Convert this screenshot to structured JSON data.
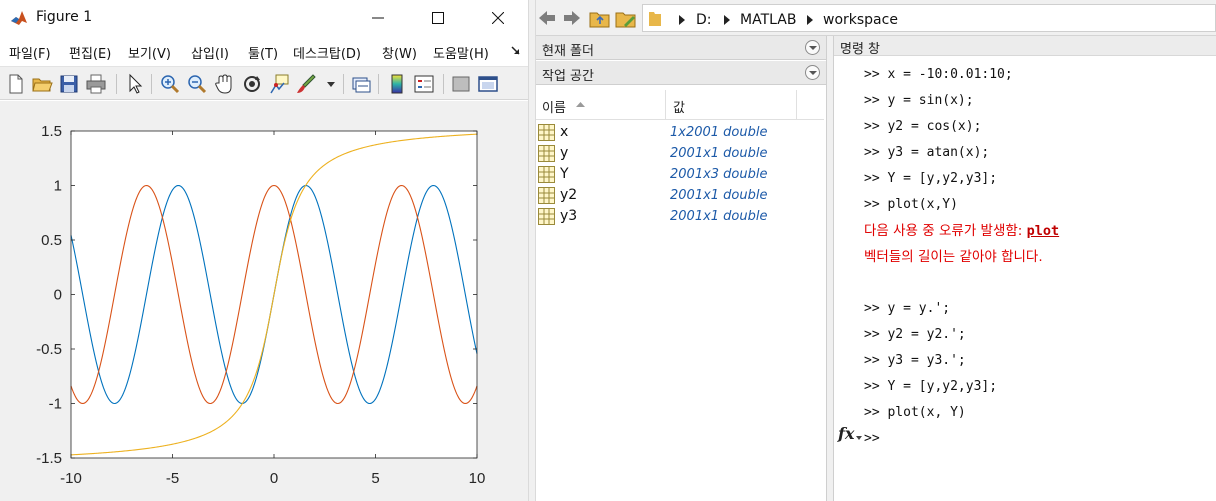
{
  "figure": {
    "title": "Figure 1",
    "menu": [
      "파일(F)",
      "편집(E)",
      "보기(V)",
      "삽입(I)",
      "툴(T)",
      "데스크탑(D)",
      "창(W)",
      "도움말(H)"
    ],
    "toolbar_icons": [
      "new-figure-icon",
      "open-file-icon",
      "save-icon",
      "print-icon",
      "select-arrow-icon",
      "zoom-in-icon",
      "zoom-out-icon",
      "pan-hand-icon",
      "rotate-3d-icon",
      "data-cursor-icon",
      "brush-icon",
      "brush-dropdown-icon",
      "link-plot-icon",
      "colorbar-icon",
      "legend-icon",
      "hide-plot-tools-icon",
      "show-plot-tools-icon"
    ]
  },
  "address": {
    "segments": [
      "D:",
      "MATLAB",
      "workspace"
    ]
  },
  "panes": {
    "current_folder_title": "현재 폴더",
    "workspace_title": "작업 공간",
    "columns": {
      "name": "이름",
      "value": "값"
    }
  },
  "workspace": [
    {
      "name": "x",
      "value": "1x2001 double"
    },
    {
      "name": "y",
      "value": "2001x1 double"
    },
    {
      "name": "Y",
      "value": "2001x3 double"
    },
    {
      "name": "y2",
      "value": "2001x1 double"
    },
    {
      "name": "y3",
      "value": "2001x1 double"
    }
  ],
  "command_window": {
    "title": "명령 창",
    "lines": [
      {
        "text": ">> x = -10:0.01:10;",
        "type": "input"
      },
      {
        "text": ">> y = sin(x);",
        "type": "input"
      },
      {
        "text": ">> y2 = cos(x);",
        "type": "input"
      },
      {
        "text": ">> y3 = atan(x);",
        "type": "input"
      },
      {
        "text": ">> Y = [y,y2,y3];",
        "type": "input"
      },
      {
        "text": ">> plot(x,Y)",
        "type": "input"
      },
      {
        "text": "다음 사용 중 오류가 발생함: ",
        "link": "plot",
        "type": "error"
      },
      {
        "text": "벡터들의 길이는 같아야 합니다.",
        "type": "error"
      },
      {
        "text": "",
        "type": "blank"
      },
      {
        "text": ">> y = y.';",
        "type": "input"
      },
      {
        "text": ">> y2 = y2.';",
        "type": "input"
      },
      {
        "text": ">> y3 = y3.';",
        "type": "input"
      },
      {
        "text": ">> Y = [y,y2,y3];",
        "type": "input"
      },
      {
        "text": ">> plot(x, Y)",
        "type": "input"
      },
      {
        "text": ">> ",
        "type": "prompt"
      }
    ],
    "fx_label": "fx"
  },
  "chart_data": {
    "type": "line",
    "title": "",
    "xlabel": "",
    "ylabel": "",
    "xlim": [
      -10,
      10
    ],
    "ylim": [
      -1.5,
      1.5
    ],
    "xticks": [
      "-10",
      "-5",
      "0",
      "5",
      "10"
    ],
    "yticks": [
      "-1.5",
      "-1",
      "-0.5",
      "0",
      "0.5",
      "1",
      "1.5"
    ],
    "x": {
      "start": -10,
      "end": 10,
      "step": 0.01
    },
    "series": [
      {
        "function": "sin(x)",
        "color": "#0072BD"
      },
      {
        "function": "cos(x)",
        "color": "#D95319"
      },
      {
        "function": "atan(x)",
        "color": "#EDB120"
      }
    ],
    "grid": false,
    "legend": "none"
  }
}
